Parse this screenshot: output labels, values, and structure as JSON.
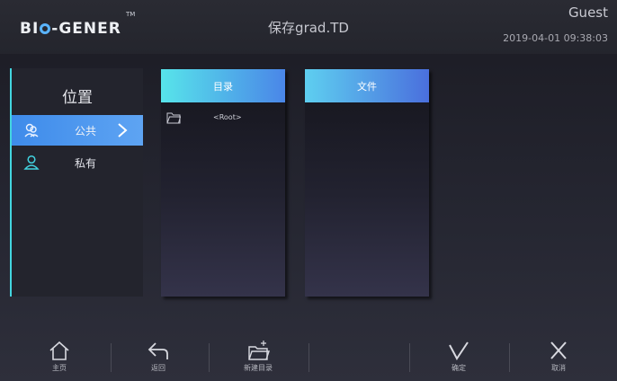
{
  "header": {
    "logo": "BIO-GENER",
    "trademark": "TM",
    "title": "保存grad.TD",
    "user": "Guest",
    "datetime": "2019-04-01 09:38:03"
  },
  "location": {
    "label": "位置",
    "items": [
      {
        "label": "公共",
        "icon": "users-icon",
        "selected": true
      },
      {
        "label": "私有",
        "icon": "user-icon",
        "selected": false
      }
    ]
  },
  "columns": {
    "directory": {
      "header": "目录",
      "rows": [
        {
          "icon": "folder-icon",
          "label": "<Root>"
        }
      ]
    },
    "files": {
      "header": "文件"
    }
  },
  "toolbar": {
    "home": "主页",
    "back": "返回",
    "new_dir": "新建目录",
    "confirm": "确定",
    "cancel": "取消"
  },
  "colors": {
    "accent_cyan": "#57e4ea",
    "accent_blue": "#4a86e8",
    "selected_item": "#4a96ef"
  }
}
